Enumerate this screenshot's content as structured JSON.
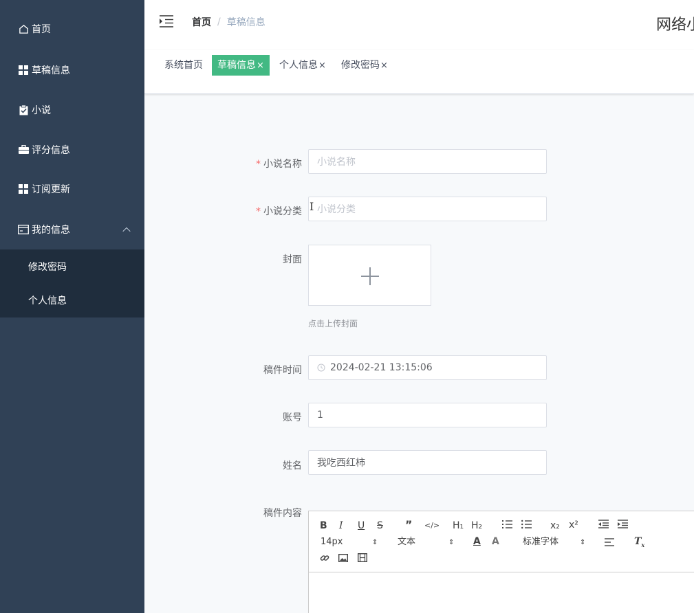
{
  "sidebar": {
    "items": [
      {
        "label": "首页",
        "icon": "home-icon"
      },
      {
        "label": "草稿信息",
        "icon": "grid-icon"
      },
      {
        "label": "小说",
        "icon": "clipboard-check-icon"
      },
      {
        "label": "评分信息",
        "icon": "briefcase-icon"
      },
      {
        "label": "订阅更新",
        "icon": "grid-icon"
      },
      {
        "label": "我的信息",
        "icon": "card-icon"
      }
    ],
    "submenu": [
      {
        "label": "修改密码"
      },
      {
        "label": "个人信息"
      }
    ]
  },
  "header": {
    "breadcrumb_home": "首页",
    "breadcrumb_sep": "/",
    "breadcrumb_current": "草稿信息",
    "site_title": "网络小"
  },
  "tags": [
    {
      "label": "系统首页"
    },
    {
      "label": "草稿信息",
      "active": true
    },
    {
      "label": "个人信息"
    },
    {
      "label": "修改密码"
    }
  ],
  "tag_close": "×",
  "form": {
    "novel_name": {
      "label": "小说名称",
      "required": "*",
      "placeholder": "小说名称"
    },
    "novel_category": {
      "label": "小说分类",
      "required": "*",
      "placeholder": "小说分类"
    },
    "cover": {
      "label": "封面",
      "hint": "点击上传封面"
    },
    "draft_time": {
      "label": "稿件时间",
      "value": "2024-02-21 13:15:06"
    },
    "account": {
      "label": "账号",
      "value": "1"
    },
    "name": {
      "label": "姓名",
      "value": "我吃西红柿"
    },
    "content": {
      "label": "稿件内容"
    }
  },
  "editor": {
    "bold": "B",
    "italic": "I",
    "underline": "U",
    "strike": "S",
    "h1": "H₁",
    "h2": "H₂",
    "sub": "x₂",
    "sup": "x²",
    "font_size": "14px",
    "font_style": "文本",
    "font_family": "标准字体"
  },
  "colors": {
    "sidebar_bg": "#304156",
    "submenu_bg": "#1f2d3d",
    "active_tag": "#42b983",
    "required": "#f56c6c"
  }
}
